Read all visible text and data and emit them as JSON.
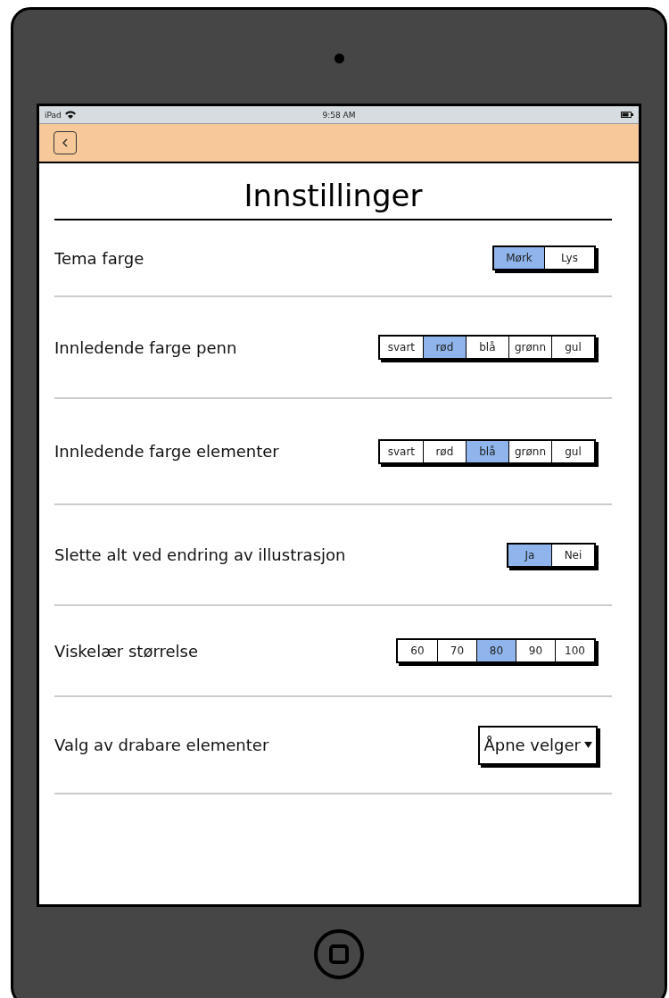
{
  "status_bar": {
    "carrier": "iPad",
    "time": "9:58 AM"
  },
  "title": "Innstillinger",
  "settings": [
    {
      "label": "Tema farge",
      "kind": "segmented",
      "options": [
        {
          "label": "Mørk",
          "selected": true
        },
        {
          "label": "Lys",
          "selected": false
        }
      ]
    },
    {
      "label": "Innledende farge penn",
      "kind": "segmented",
      "options": [
        {
          "label": "svart",
          "selected": false
        },
        {
          "label": "rød",
          "selected": true
        },
        {
          "label": "blå",
          "selected": false
        },
        {
          "label": "grønn",
          "selected": false
        },
        {
          "label": "gul",
          "selected": false
        }
      ]
    },
    {
      "label": "Innledende farge elementer",
      "kind": "segmented",
      "options": [
        {
          "label": "svart",
          "selected": false
        },
        {
          "label": "rød",
          "selected": false
        },
        {
          "label": "blå",
          "selected": true
        },
        {
          "label": "grønn",
          "selected": false
        },
        {
          "label": "gul",
          "selected": false
        }
      ]
    },
    {
      "label": "Slette alt ved endring av illustrasjon",
      "kind": "segmented",
      "options": [
        {
          "label": "Ja",
          "selected": true
        },
        {
          "label": "Nei",
          "selected": false
        }
      ]
    },
    {
      "label": "Viskelær størrelse",
      "kind": "segmented",
      "options": [
        {
          "label": "60",
          "selected": false
        },
        {
          "label": "70",
          "selected": false
        },
        {
          "label": "80",
          "selected": true
        },
        {
          "label": "90",
          "selected": false
        },
        {
          "label": "100",
          "selected": false
        }
      ]
    },
    {
      "label": "Valg av drabare elementer",
      "kind": "dropdown",
      "value": "Åpne velger"
    }
  ]
}
